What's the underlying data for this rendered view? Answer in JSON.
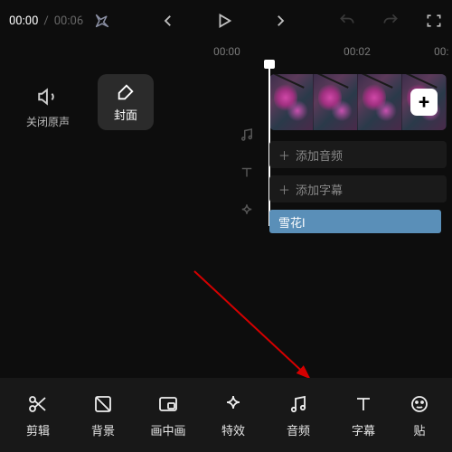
{
  "topbar": {
    "current_time": "00:00",
    "time_separator": "/",
    "duration": "00:06"
  },
  "ruler": {
    "ticks": [
      "00:00",
      "00:02",
      "00:"
    ]
  },
  "left_panel": {
    "mute_label": "关闭原声",
    "cover_label": "封面"
  },
  "tracks": {
    "add_audio_label": "添加音频",
    "add_subtitle_label": "添加字幕",
    "effect_clip_label": "雪花I",
    "plus_glyph": "＋",
    "add_plus": "+"
  },
  "bottom_tools": [
    {
      "id": "cut",
      "label": "剪辑"
    },
    {
      "id": "background",
      "label": "背景"
    },
    {
      "id": "pip",
      "label": "画中画"
    },
    {
      "id": "effects",
      "label": "特效"
    },
    {
      "id": "audio",
      "label": "音频"
    },
    {
      "id": "subtitle",
      "label": "字幕"
    },
    {
      "id": "sticker",
      "label": "贴"
    }
  ]
}
